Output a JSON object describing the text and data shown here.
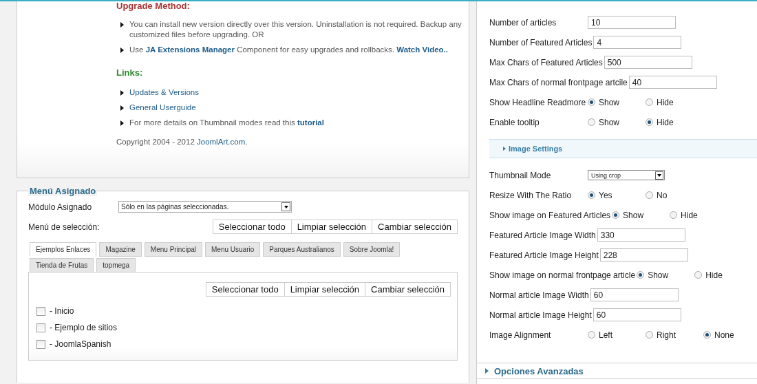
{
  "info": {
    "heading": "Upgrade Method:",
    "upgrade_items": [
      {
        "parts": [
          {
            "text": "You can install new version directly over this version. Uninstallation is not required. Backup any customized files before upgrading. OR",
            "link": false
          }
        ]
      },
      {
        "parts": [
          {
            "text": "Use ",
            "link": false
          },
          {
            "text": "JA Extensions Manager",
            "link": true
          },
          {
            "text": " Component for easy upgrades and rollbacks. ",
            "link": false
          },
          {
            "text": "Watch Video..",
            "link": true
          }
        ]
      }
    ],
    "links_heading": "Links:",
    "links": [
      {
        "parts": [
          {
            "text": "Updates & Versions",
            "link": true
          }
        ]
      },
      {
        "parts": [
          {
            "text": "General Userguide",
            "link": true
          }
        ]
      },
      {
        "parts": [
          {
            "text": "For more details on Thumbnail modes read this ",
            "link": false
          },
          {
            "text": "tutorial",
            "link": true
          }
        ]
      }
    ],
    "copyright": {
      "parts": [
        {
          "text": "Copyright 2004 - 2012 ",
          "link": false
        },
        {
          "text": "JoomlArt.com",
          "link": true
        },
        {
          "text": ".",
          "link": false
        }
      ]
    }
  },
  "menu": {
    "legend": "Menú Asignado",
    "module_label": "Módulo Asignado",
    "module_value": "Sólo en las páginas seleccionadas.",
    "selection_label": "Menú de selección:",
    "buttons": [
      "Seleccionar todo",
      "Limpiar selección",
      "Cambiar selección"
    ],
    "tabs": [
      {
        "label": "Ejemplos Enlaces",
        "selected": true
      },
      {
        "label": "Magazine",
        "selected": false
      },
      {
        "label": "Menu Principal",
        "selected": false
      },
      {
        "label": "Menu Usuario",
        "selected": false
      },
      {
        "label": "Parques Australianos",
        "selected": false
      },
      {
        "label": "Sobre Joomla!",
        "selected": false
      },
      {
        "label": "Tienda de Frutas",
        "selected": false
      },
      {
        "label": "topmega",
        "selected": false
      }
    ],
    "tab_buttons": [
      "Seleccionar todo",
      "Limpiar selección",
      "Cambiar selección"
    ],
    "items": [
      {
        "label": "- Inicio",
        "checked": false
      },
      {
        "label": "- Ejemplo de sitios",
        "checked": false
      },
      {
        "label": "- JoomlaSpanish",
        "checked": false
      }
    ]
  },
  "settings": {
    "fields": [
      {
        "kind": "text",
        "label": "Number of articles",
        "value": "10"
      },
      {
        "kind": "text",
        "label": "Number of Featured Articles",
        "value": "4"
      },
      {
        "kind": "text",
        "label": "Max Chars of Featured Articles",
        "value": "500"
      },
      {
        "kind": "text",
        "label": "Max Chars of normal frontpage artcile",
        "value": "40"
      },
      {
        "kind": "radio",
        "label": "Show Headline Readmore",
        "options": [
          {
            "label": "Show",
            "selected": true
          },
          {
            "label": "Hide",
            "selected": false
          }
        ]
      },
      {
        "kind": "radio",
        "label": "Enable tooltip",
        "options": [
          {
            "label": "Show",
            "selected": false
          },
          {
            "label": "Hide",
            "selected": true
          }
        ]
      },
      {
        "kind": "section",
        "label": "Image Settings"
      },
      {
        "kind": "select",
        "label": "Thumbnail Mode",
        "value": "Using crop"
      },
      {
        "kind": "radio",
        "label": "Resize With The Ratio",
        "options": [
          {
            "label": "Yes",
            "selected": true
          },
          {
            "label": "No",
            "selected": false
          }
        ]
      },
      {
        "kind": "radio",
        "label": "Show image on Featured Articles",
        "options": [
          {
            "label": "Show",
            "selected": true
          },
          {
            "label": "Hide",
            "selected": false
          }
        ]
      },
      {
        "kind": "text",
        "label": "Featured Article Image Width",
        "value": "330"
      },
      {
        "kind": "text",
        "label": "Featured Article Image Height",
        "value": "228"
      },
      {
        "kind": "radio",
        "label": "Show image on normal frontpage article",
        "options": [
          {
            "label": "Show",
            "selected": true
          },
          {
            "label": "Hide",
            "selected": false
          }
        ]
      },
      {
        "kind": "text",
        "label": "Normal article Image Width",
        "value": "60"
      },
      {
        "kind": "text",
        "label": "Normal article Image Height",
        "value": "60"
      },
      {
        "kind": "radio",
        "label": "Image Alignment",
        "options": [
          {
            "label": "Left",
            "selected": false
          },
          {
            "label": "Right",
            "selected": false
          },
          {
            "label": "None",
            "selected": true
          }
        ]
      }
    ],
    "footer": "Opciones Avanzadas"
  }
}
